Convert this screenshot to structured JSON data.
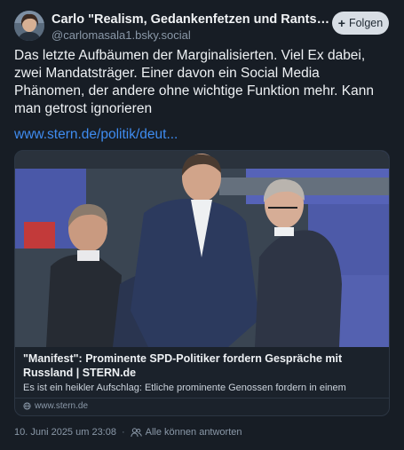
{
  "author": {
    "name": "Carlo \"Realism, Gedankenfetzen und Rants\" Mas...",
    "handle": "@carlomasala1.bsky.social",
    "avatar_icon": "person-avatar"
  },
  "follow_button": {
    "label": "Folgen",
    "icon": "plus-icon"
  },
  "post": {
    "text": "Das letzte Aufbäumen der Marginalisierten. Viel Ex dabei, zwei Mandatsträger. Einer davon ein Social Media Phänomen, der andere ohne wichtige Funktion mehr. Kann man getrost ignorieren",
    "link_text": "www.stern.de/politik/deut..."
  },
  "link_card": {
    "title": "\"Manifest\": Prominente SPD-Politiker fordern Gespräche mit Russland | STERN.de",
    "description": "Es ist ein heikler Aufschlag: Etliche prominente Genossen fordern in einem",
    "domain": "www.stern.de",
    "image_icon": "parliament-photo"
  },
  "meta": {
    "timestamp": "10. Juni 2025 um 23:08",
    "reply_setting": "Alle können antworten",
    "reply_icon": "people-icon"
  },
  "colors": {
    "background": "#171d25",
    "link": "#3f8cf0",
    "muted": "#8a98a8",
    "button_bg": "#d8dee5"
  }
}
